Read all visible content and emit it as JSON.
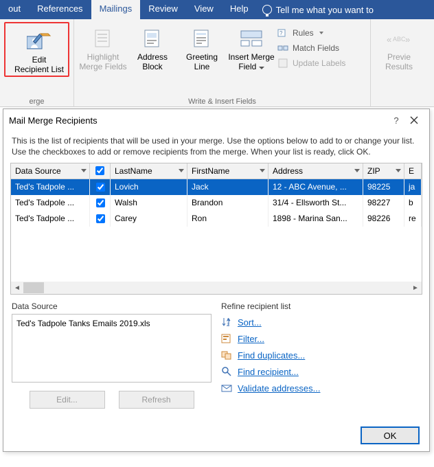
{
  "tabs": {
    "t0": "out",
    "t1": "References",
    "t2": "Mailings",
    "t3": "Review",
    "t4": "View",
    "t5": "Help"
  },
  "tell": "Tell me what you want to",
  "ribbon": {
    "editRecip1": "Edit",
    "editRecip2": "Recipient List",
    "highlight1": "Highlight",
    "highlight2": "Merge Fields",
    "addr1": "Address",
    "addr2": "Block",
    "greet1": "Greeting",
    "greet2": "Line",
    "insert1": "Insert Merge",
    "insert2": "Field",
    "rules": "Rules",
    "match": "Match Fields",
    "update": "Update Labels",
    "preview1": "Previe",
    "preview2": "Results",
    "grp1": "erge",
    "grp2": "Write & Insert Fields"
  },
  "dialog": {
    "title": "Mail Merge Recipients",
    "help": "?",
    "desc": "This is the list of recipients that will be used in your merge.  Use the options below to add to or change your list.  Use the checkboxes to add or remove recipients from the merge.  When your list is ready, click OK.",
    "cols": {
      "c0": "Data Source",
      "c1": "LastName",
      "c2": "FirstName",
      "c3": "Address",
      "c4": "ZIP",
      "c5": "E"
    },
    "rows": [
      {
        "ds": "Ted's Tadpole ...",
        "ln": "Lovich",
        "fn": "Jack",
        "addr": "12 - ABC Avenue, ...",
        "zip": "98225",
        "e": "ja"
      },
      {
        "ds": "Ted's Tadpole ...",
        "ln": "Walsh",
        "fn": "Brandon",
        "addr": "31/4 - Ellsworth St...",
        "zip": "98227",
        "e": "b"
      },
      {
        "ds": "Ted's Tadpole ...",
        "ln": "Carey",
        "fn": "Ron",
        "addr": "1898 - Marina San...",
        "zip": "98226",
        "e": "re"
      }
    ],
    "dslabel": "Data Source",
    "dsfile": "Ted's Tadpole Tanks Emails 2019.xls",
    "editBtn": "Edit...",
    "refreshBtn": "Refresh",
    "refinelabel": "Refine recipient list",
    "sort": "Sort...",
    "filter": "Filter...",
    "dups": "Find duplicates...",
    "find": "Find recipient...",
    "validate": "Validate addresses...",
    "ok": "OK"
  }
}
